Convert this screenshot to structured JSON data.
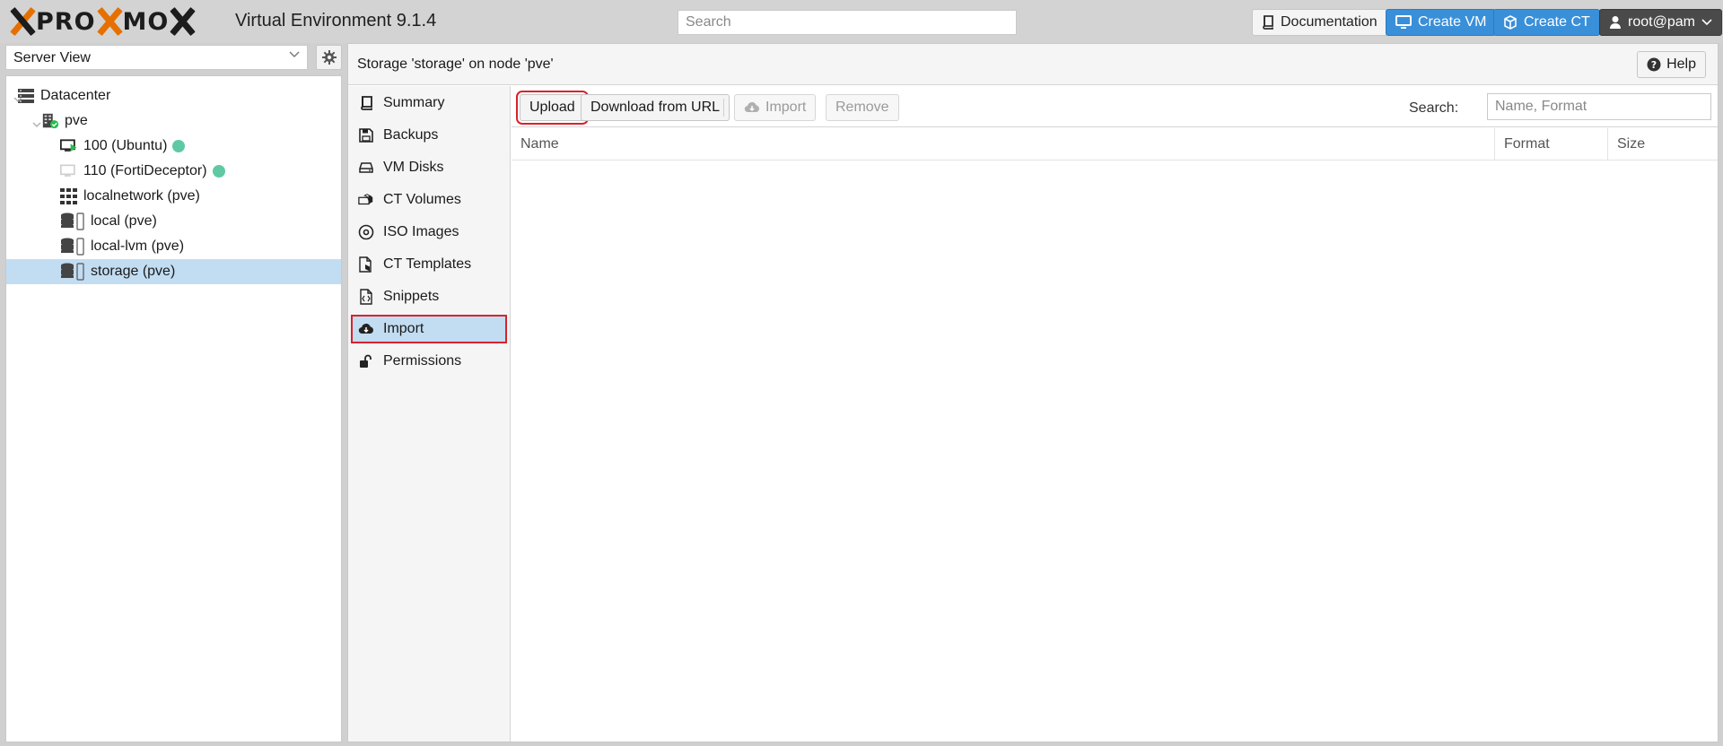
{
  "header": {
    "logo_left": "PRO",
    "logo_mid": "MO",
    "version": "Virtual Environment 9.1.4",
    "search_placeholder": "Search",
    "documentation_label": "Documentation",
    "create_vm_label": "Create VM",
    "create_ct_label": "Create CT",
    "user_label": "root@pam"
  },
  "tree": {
    "view_label": "Server View",
    "nodes": [
      {
        "label": "Datacenter",
        "icon": "datacenter-icon"
      },
      {
        "label": "pve",
        "icon": "server-online-icon"
      },
      {
        "label": "100 (Ubuntu)",
        "icon": "vm-running-icon",
        "status": "running"
      },
      {
        "label": "110 (FortiDeceptor)",
        "icon": "vm-stopped-icon",
        "status": "running"
      },
      {
        "label": "localnetwork (pve)",
        "icon": "network-grid-icon"
      },
      {
        "label": "local (pve)",
        "icon": "storage-icon"
      },
      {
        "label": "local-lvm (pve)",
        "icon": "storage-icon"
      },
      {
        "label": "storage (pve)",
        "icon": "storage-icon",
        "selected": true
      }
    ]
  },
  "content": {
    "title": "Storage 'storage' on node 'pve'",
    "help_label": "Help",
    "nav": [
      {
        "label": "Summary",
        "icon": "book-icon"
      },
      {
        "label": "Backups",
        "icon": "floppy-icon"
      },
      {
        "label": "VM Disks",
        "icon": "hdd-icon"
      },
      {
        "label": "CT Volumes",
        "icon": "ct-volume-icon"
      },
      {
        "label": "ISO Images",
        "icon": "disc-icon"
      },
      {
        "label": "CT Templates",
        "icon": "ct-template-icon"
      },
      {
        "label": "Snippets",
        "icon": "code-file-icon"
      },
      {
        "label": "Import",
        "icon": "cloud-download-icon",
        "active": true
      },
      {
        "label": "Permissions",
        "icon": "unlock-icon"
      }
    ],
    "toolbar": {
      "upload_label": "Upload",
      "download_label": "Download from URL",
      "import_label": "Import",
      "remove_label": "Remove",
      "search_label": "Search:",
      "search_placeholder": "Name, Format"
    },
    "columns": [
      "Name",
      "Format",
      "Size"
    ]
  },
  "colors": {
    "accent_orange": "#e57000",
    "primary_blue": "#3a8fd9",
    "selection_blue": "#c2ddf2",
    "highlight_red": "#d8222b",
    "status_green": "#5fc9a4"
  }
}
